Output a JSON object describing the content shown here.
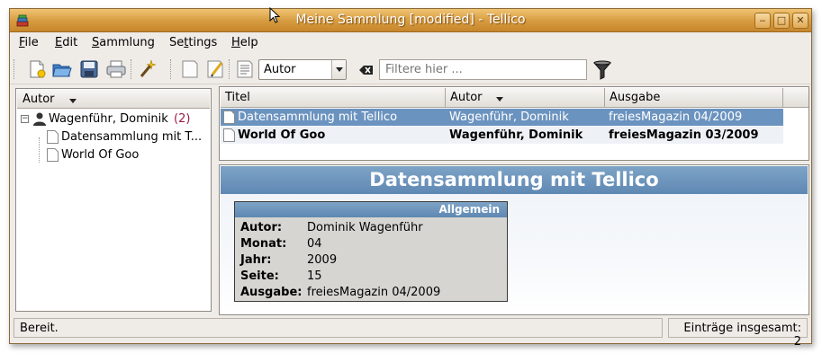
{
  "window": {
    "title": "Meine Sammlung [modified] - Tellico",
    "buttons": {
      "minimize": "‒",
      "maximize": "□",
      "close": "✕"
    }
  },
  "menubar": {
    "items": [
      {
        "label": "File",
        "mnemonic": "F",
        "rest": "ile"
      },
      {
        "label": "Edit",
        "mnemonic": "E",
        "rest": "dit"
      },
      {
        "label": "Sammlung",
        "mnemonic": "S",
        "rest": "ammlung"
      },
      {
        "label": "Settings",
        "prefix": "Se",
        "mnemonic": "t",
        "rest": "tings"
      },
      {
        "label": "Help",
        "mnemonic": "H",
        "rest": "elp"
      }
    ]
  },
  "toolbar": {
    "icons": [
      "new-document-icon",
      "open-folder-icon",
      "save-disk-icon",
      "print-icon",
      "magic-wand-icon",
      "new-entry-icon",
      "edit-entry-icon",
      "report-icon"
    ],
    "group_by": {
      "selected": "Autor"
    },
    "filter": {
      "placeholder": "Filtere hier ...",
      "value": ""
    }
  },
  "tree": {
    "header": "Autor",
    "groups": [
      {
        "label": "Wagenführ, Dominik",
        "count": "(2)",
        "children": [
          "Datensammlung mit T...",
          "World Of Goo"
        ]
      }
    ]
  },
  "list": {
    "columns": [
      "Titel",
      "Autor",
      "Ausgabe"
    ],
    "rows": [
      {
        "titel": "Datensammlung mit Tellico",
        "autor": "Wagenführ, Dominik",
        "ausgabe": "freiesMagazin 04/2009",
        "selected": true
      },
      {
        "titel": "World Of Goo",
        "autor": "Wagenführ, Dominik",
        "ausgabe": "freiesMagazin 03/2009",
        "selected": false
      }
    ]
  },
  "detail": {
    "title": "Datensammlung mit Tellico",
    "group_title": "Allgemein",
    "fields": [
      {
        "key": "Autor:",
        "value": "Dominik Wagenführ"
      },
      {
        "key": "Monat:",
        "value": "04"
      },
      {
        "key": "Jahr:",
        "value": "2009"
      },
      {
        "key": "Seite:",
        "value": "15"
      },
      {
        "key": "Ausgabe:",
        "value": "freiesMagazin 04/2009"
      }
    ]
  },
  "statusbar": {
    "message": "Bereit.",
    "total": "Einträge insgesamt: 2"
  },
  "colors": {
    "titlebar": "#d69a3e",
    "selection": "#6b93bf",
    "detail_header": "#5e88b3",
    "count": "#9a1a4a"
  }
}
